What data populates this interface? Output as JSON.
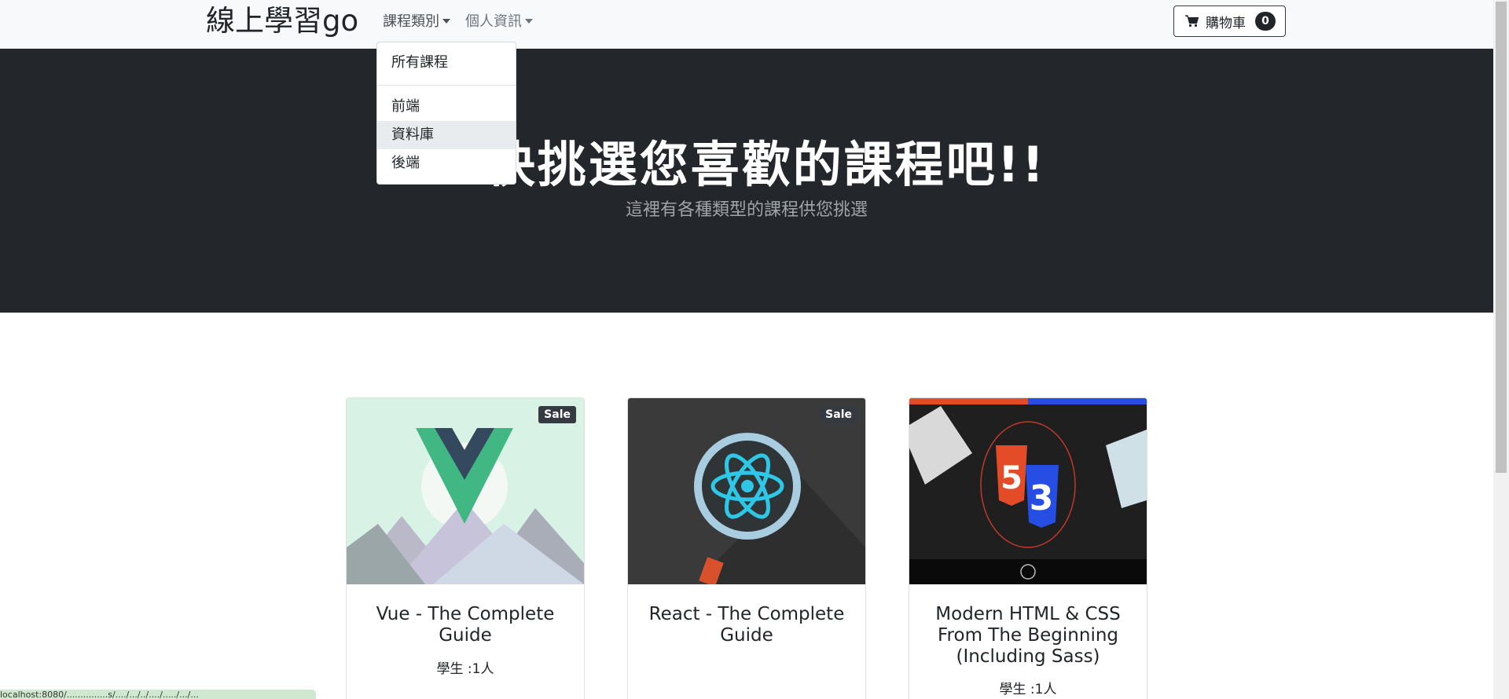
{
  "navbar": {
    "brand": "線上學習go",
    "nav_categories": "課程類別",
    "nav_profile": "個人資訊",
    "cart_label": "購物車",
    "cart_count": "0"
  },
  "dropdown": {
    "items": [
      "所有課程",
      "前端",
      "資料庫",
      "後端"
    ]
  },
  "hero": {
    "title": "快挑選您喜歡的課程吧!!",
    "subtitle": "這裡有各種類型的課程供您挑選"
  },
  "courses": [
    {
      "title": "Vue - The Complete Guide",
      "badge": "Sale",
      "students": "學生 :1人",
      "image": "vue-logo"
    },
    {
      "title": "React - The Complete Guide",
      "badge": "Sale",
      "students": "",
      "image": "react-logo"
    },
    {
      "title": "Modern HTML & CSS From The Beginning (Including Sass)",
      "badge": "",
      "students": "學生 :1人",
      "image": "html-css-sass"
    }
  ],
  "status_bar": "localhost:8080/...............s/..../.../../..../...../.../..."
}
